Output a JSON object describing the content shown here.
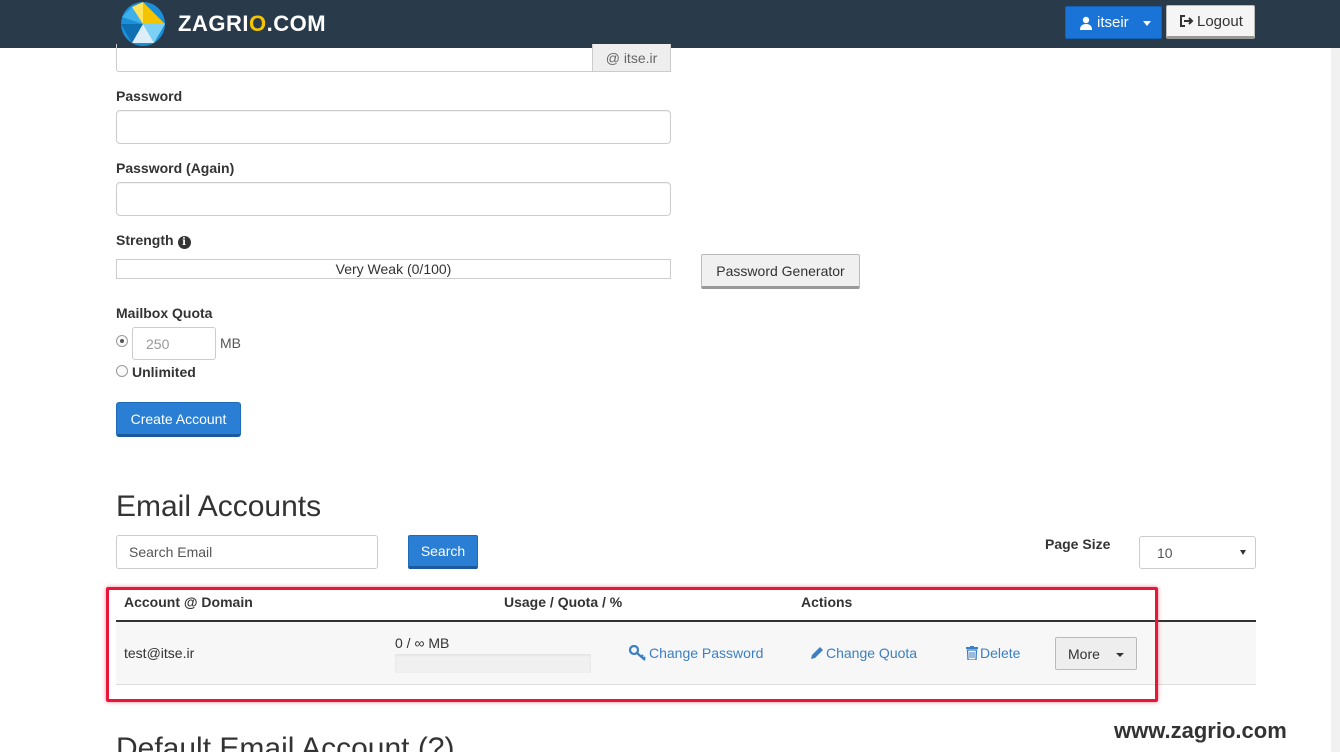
{
  "header": {
    "logo_text_a": "ZAGRI",
    "logo_text_o": "O",
    "logo_text_b": ".COM",
    "user_label": "itseir",
    "logout_label": "Logout"
  },
  "form": {
    "domain_addon": "@ itse.ir",
    "password_label": "Password",
    "password_again_label": "Password (Again)",
    "strength_label": "Strength",
    "strength_value": "Very Weak (0/100)",
    "password_generator_label": "Password Generator",
    "mailbox_quota_label": "Mailbox Quota",
    "quota_value": "250",
    "quota_unit": "MB",
    "unlimited_label": "Unlimited",
    "create_account_label": "Create Account"
  },
  "email_accounts": {
    "heading": "Email Accounts",
    "search_placeholder": "Search Email",
    "search_label": "Search",
    "page_size_label": "Page Size",
    "page_size_value": "10",
    "columns": [
      "Account @ Domain",
      "Usage / Quota / %",
      "Actions"
    ],
    "rows": [
      {
        "account": "test@itse.ir",
        "usage": "0 / ∞ MB",
        "usage_percent": 0,
        "change_password": "Change Password",
        "change_quota": "Change Quota",
        "delete": "Delete",
        "more": "More"
      }
    ]
  },
  "default_section": {
    "heading": "Default Email Account (?)"
  },
  "watermark": "www.zagrio.com",
  "colors": {
    "navbar": "#293a4a",
    "primary": "#2a7fd4",
    "link": "#3b7fc4",
    "highlight": "#e8173a"
  }
}
